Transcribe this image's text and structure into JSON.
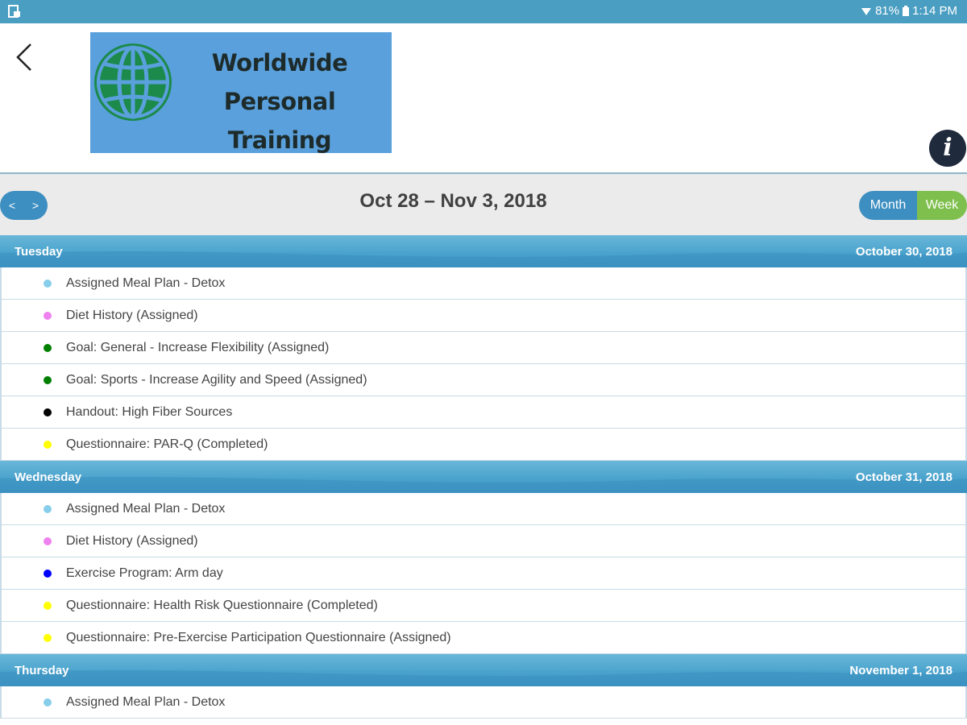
{
  "status_bar": {
    "battery": "81%",
    "time": "1:14 PM"
  },
  "header": {
    "logo_line1": "Worldwide",
    "logo_line2": "Personal Training",
    "info_label": "i"
  },
  "toolbar": {
    "prev_label": "<",
    "next_label": ">",
    "range_title": "Oct 28 – Nov 3, 2018",
    "month_label": "Month",
    "week_label": "Week",
    "active_view": "Week"
  },
  "colors": {
    "meal_plan": "#87ceeb",
    "diet_history": "#ee82ee",
    "goal": "#008000",
    "handout": "#000000",
    "questionnaire": "#ffff00",
    "exercise": "#0000ff"
  },
  "days": [
    {
      "name": "Tuesday",
      "date": "October 30, 2018",
      "items": [
        {
          "label": "Assigned Meal Plan - Detox",
          "color": "#87ceeb"
        },
        {
          "label": "Diet History (Assigned)",
          "color": "#ee82ee"
        },
        {
          "label": "Goal: General - Increase Flexibility (Assigned)",
          "color": "#008000"
        },
        {
          "label": "Goal: Sports - Increase Agility and Speed (Assigned)",
          "color": "#008000"
        },
        {
          "label": "Handout: High Fiber Sources",
          "color": "#000000"
        },
        {
          "label": "Questionnaire: PAR-Q (Completed)",
          "color": "#ffff00"
        }
      ]
    },
    {
      "name": "Wednesday",
      "date": "October 31, 2018",
      "items": [
        {
          "label": "Assigned Meal Plan - Detox",
          "color": "#87ceeb"
        },
        {
          "label": "Diet History (Assigned)",
          "color": "#ee82ee"
        },
        {
          "label": "Exercise Program: Arm day",
          "color": "#0000ff"
        },
        {
          "label": "Questionnaire: Health Risk Questionnaire (Completed)",
          "color": "#ffff00"
        },
        {
          "label": "Questionnaire: Pre-Exercise Participation Questionnaire (Assigned)",
          "color": "#ffff00"
        }
      ]
    },
    {
      "name": "Thursday",
      "date": "November 1, 2018",
      "items": [
        {
          "label": "Assigned Meal Plan - Detox",
          "color": "#87ceeb"
        }
      ]
    }
  ]
}
